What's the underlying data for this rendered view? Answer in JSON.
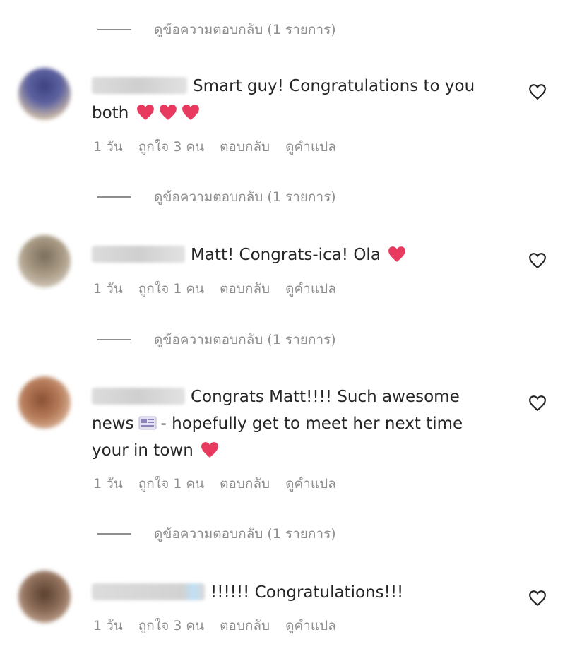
{
  "labels": {
    "view_replies": "ดูข้อความตอบกลับ (1 รายการ)",
    "reply": "ตอบกลับ",
    "see_translation": "ดูคำแปล"
  },
  "comments": [
    {
      "text_before": "Smart guy! Congratulations to you",
      "text_after": "both",
      "emoji": [
        "heart",
        "heart",
        "heart"
      ],
      "time": "1 วัน",
      "likes": "ถูกใจ 3 คน",
      "avatar_colors": [
        "#4b4f8a",
        "#c9b8a8"
      ]
    },
    {
      "text": "Matt! Congrats-ica! Ola",
      "emoji": [
        "heart"
      ],
      "time": "1 วัน",
      "likes": "ถูกใจ 1 คน",
      "avatar_colors": [
        "#9b8b72",
        "#c7b9a3"
      ]
    },
    {
      "name_suffix": "000",
      "text_line1": "Congrats Matt!!!! Such awesome",
      "text_line2a": "news",
      "text_line2b": "- hopefully get to meet her next time",
      "text_line3": "your in town",
      "emoji": [
        "newspaper",
        "heart"
      ],
      "time": "1 วัน",
      "likes": "ถูกใจ 1 คน",
      "avatar_colors": [
        "#a0684a",
        "#d9b092"
      ]
    },
    {
      "text": "!!!!!! Congratulations!!!",
      "time": "1 วัน",
      "likes": "ถูกใจ 3 คน",
      "avatar_colors": [
        "#6b5040",
        "#b89580"
      ]
    }
  ],
  "colors": {
    "heart": "#e8395f",
    "muted": "#8e8e8e",
    "text": "#262626"
  }
}
